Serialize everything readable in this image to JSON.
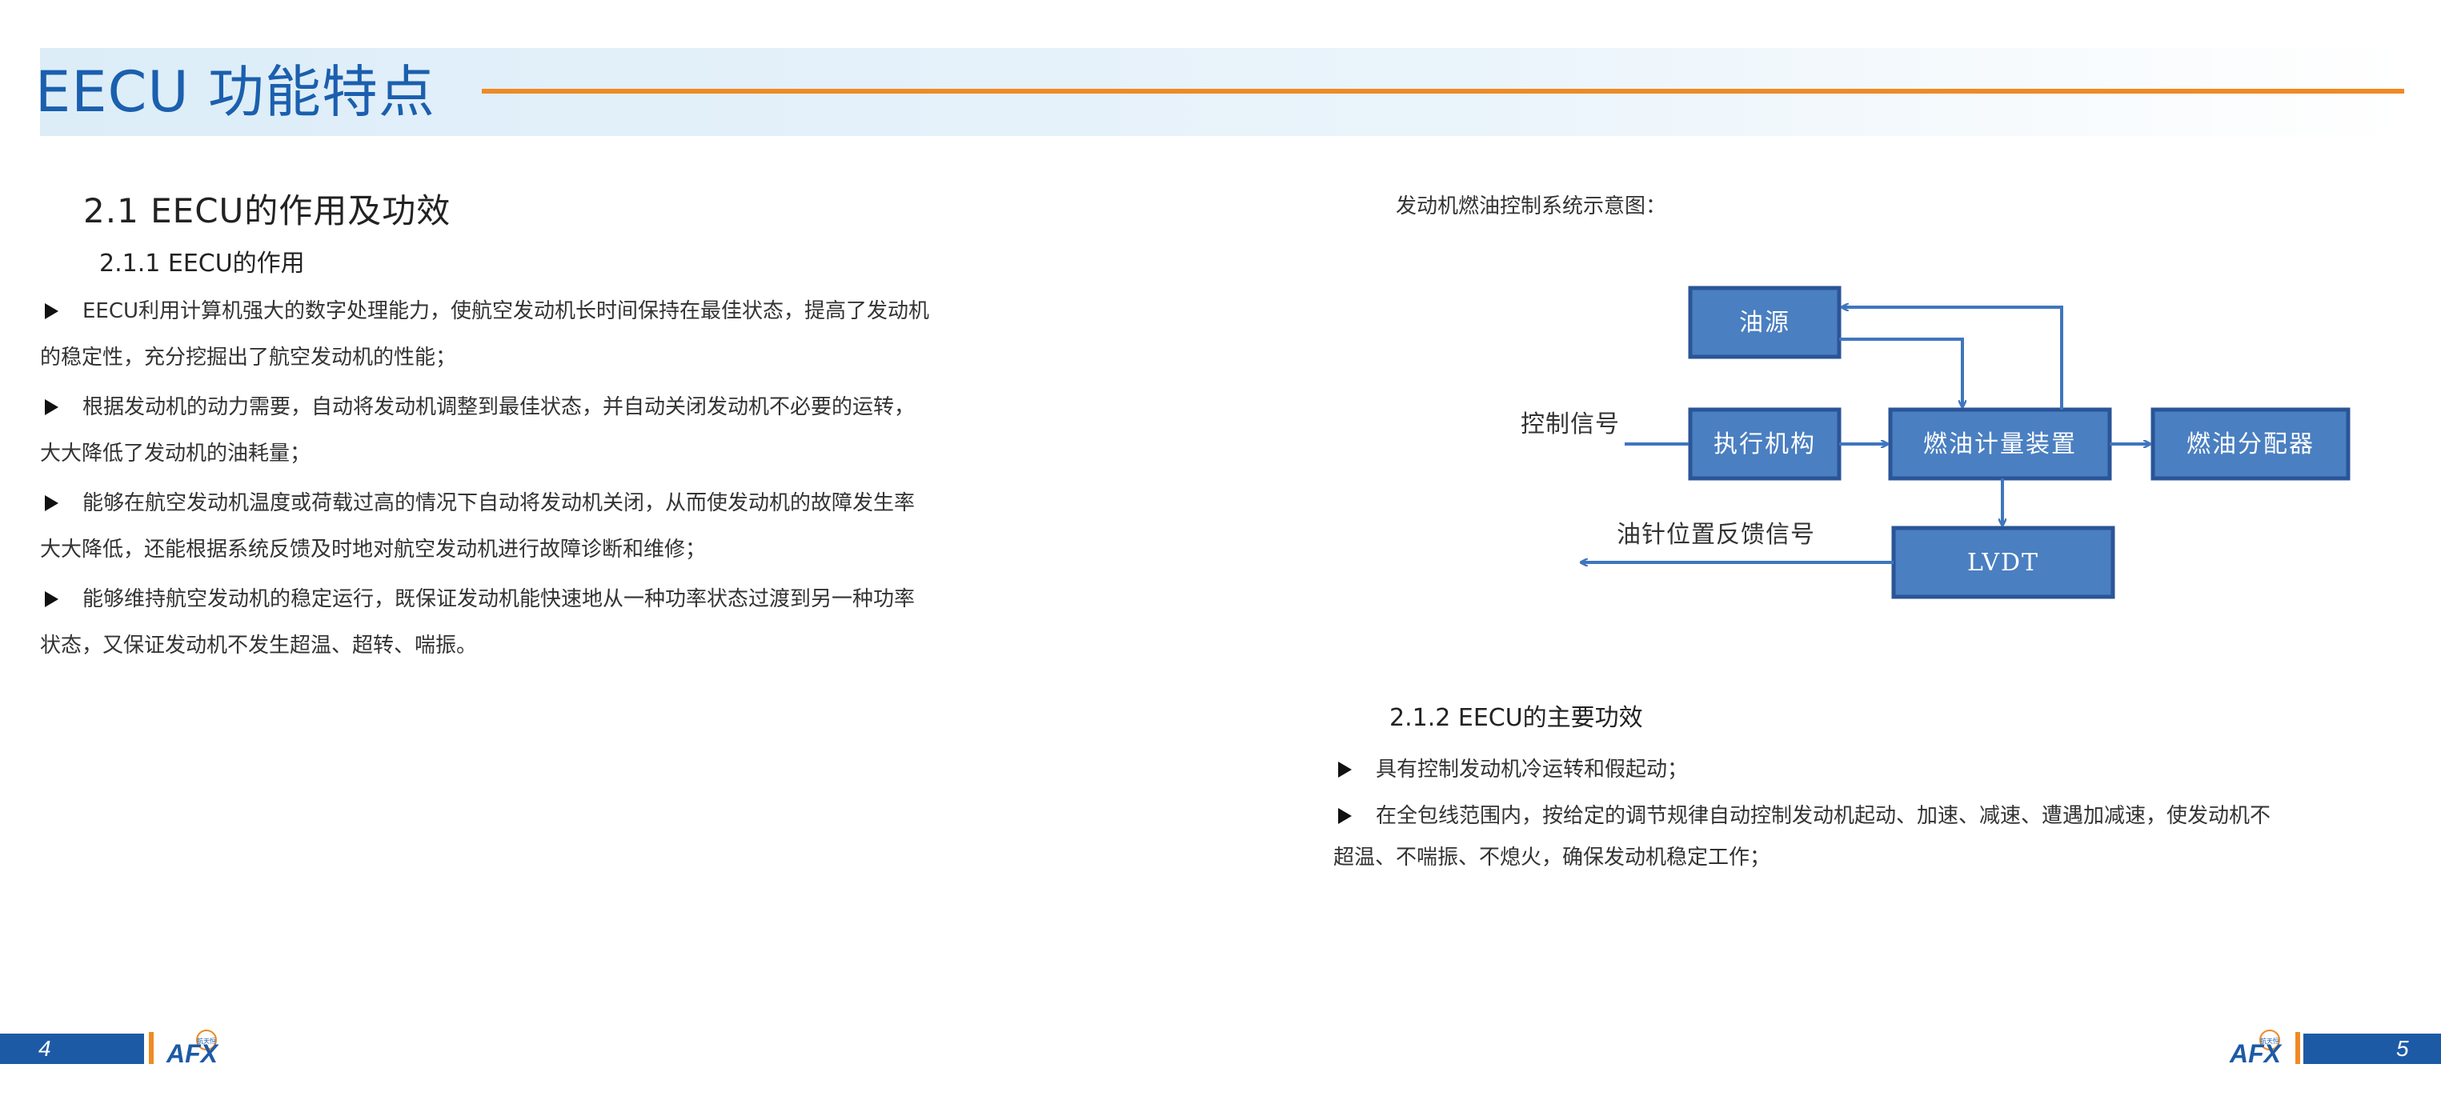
{
  "header": {
    "title": "EECU 功能特点"
  },
  "left": {
    "section_title": "2.1  EECU的作用及功效",
    "subsection_title": "2.1.1 EECU的作用",
    "bullets": [
      {
        "line1": "EECU利用计算机强大的数字处理能力，使航空发动机长时间保持在最佳状态，提高了发动机",
        "line2": "的稳定性，充分挖掘出了航空发动机的性能；"
      },
      {
        "line1": "根据发动机的动力需要，自动将发动机调整到最佳状态，并自动关闭发动机不必要的运转，",
        "line2": "大大降低了发动机的油耗量；"
      },
      {
        "line1": "能够在航空发动机温度或荷载过高的情况下自动将发动机关闭，从而使发动机的故障发生率",
        "line2": "大大降低，还能根据系统反馈及时地对航空发动机进行故障诊断和维修；"
      },
      {
        "line1": "能够维持航空发动机的稳定运行，既保证发动机能快速地从一种功率状态过渡到另一种功率",
        "line2": "状态，又保证发动机不发生超温、超转、喘振。"
      }
    ]
  },
  "right": {
    "diagram_caption": "发动机燃油控制系统示意图：",
    "diagram": {
      "oil_source": "油源",
      "actuator": "执行机构",
      "metering": "燃油计量装置",
      "distributor": "燃油分配器",
      "lvdt": "LVDT",
      "control_signal": "控制信号",
      "feedback_signal": "油针位置反馈信号",
      "box_fill": "#4a7fc1",
      "box_border": "#2a5597",
      "arrow_color": "#3f76bd"
    },
    "subsection_title": "2.1.2 EECU的主要功效",
    "bullets": [
      {
        "line1": "具有控制发动机冷运转和假起动；",
        "line2": ""
      },
      {
        "line1": "在全包线范围内，按给定的调节规律自动控制发动机起动、加速、减速、遭遇加减速，使发动机不",
        "line2": "超温、不喘振、不熄火，确保发动机稳定工作；"
      }
    ]
  },
  "footer": {
    "left_page": "4",
    "right_page": "5",
    "logo_text": "航天恒"
  },
  "colors": {
    "brand_blue": "#1b5fae",
    "accent_orange": "#f08a24",
    "footer_blue": "#1d5aa6"
  }
}
